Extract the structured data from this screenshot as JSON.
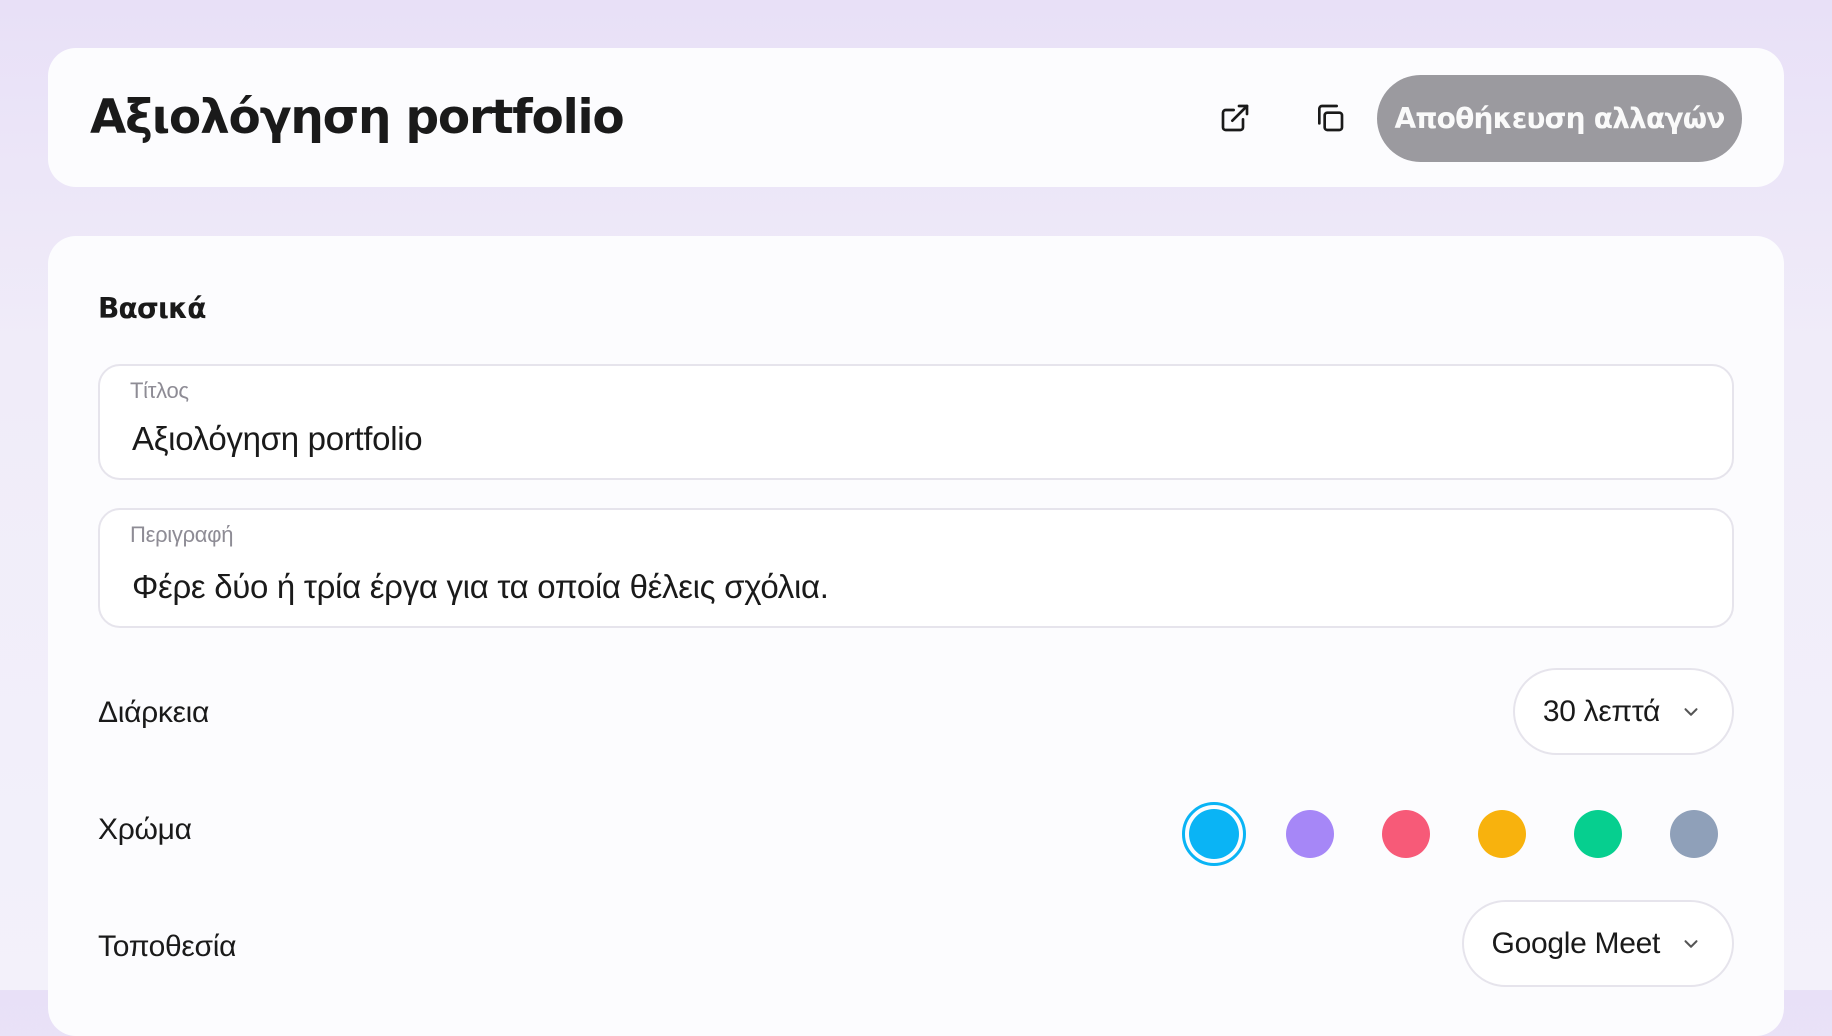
{
  "header": {
    "title": "Αξιολόγηση portfolio",
    "open_icon": "external-link-icon",
    "copy_icon": "copy-icon",
    "save_label": "Αποθήκευση αλλαγών"
  },
  "basics": {
    "section_title": "Βασικά",
    "title_field": {
      "label": "Τίτλος",
      "value": "Αξιολόγηση portfolio"
    },
    "description_field": {
      "label": "Περιγραφή",
      "value": "Φέρε δύο ή τρία έργα για τα οποία θέλεις σχόλια."
    },
    "duration": {
      "label": "Διάρκεια",
      "value": "30 λεπτά"
    },
    "color": {
      "label": "Χρώμα",
      "options": [
        "#0ab4f5",
        "#a687f7",
        "#f75a78",
        "#f8b20d",
        "#06cf8f",
        "#8fa0b9"
      ],
      "selected_index": 0
    },
    "location": {
      "label": "Τοποθεσία",
      "value": "Google Meet"
    }
  }
}
